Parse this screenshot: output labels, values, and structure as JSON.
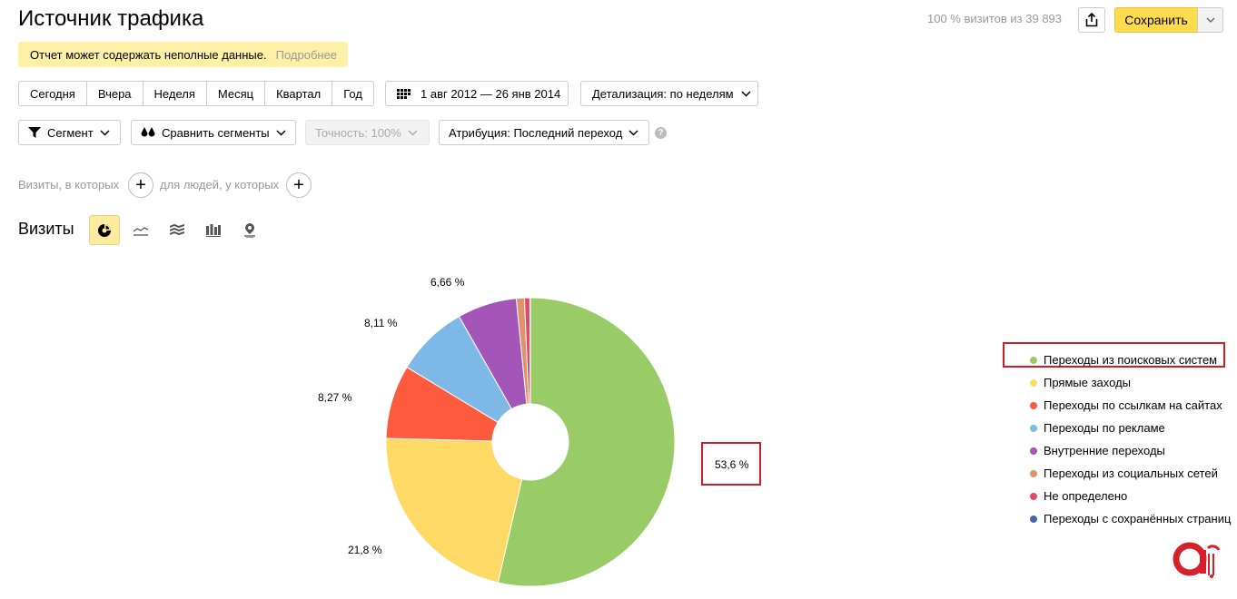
{
  "header": {
    "title": "Источник трафика",
    "visits_stat": "100 % визитов из 39 893",
    "save_label": "Сохранить"
  },
  "warning": {
    "text": "Отчет может содержать неполные данные.",
    "more": "Подробнее"
  },
  "periods": [
    "Сегодня",
    "Вчера",
    "Неделя",
    "Месяц",
    "Квартал",
    "Год"
  ],
  "date_range": "1 авг 2012 — 26 янв 2014",
  "detail": "Детализация: по неделям",
  "segments": {
    "segment": "Сегмент",
    "compare": "Сравнить сегменты",
    "accuracy": "Точность: 100%",
    "attribution": "Атрибуция: Последний переход"
  },
  "conditions": {
    "visits": "Визиты, в которых",
    "people": "для людей, у которых"
  },
  "chart_section": {
    "title": "Визиты"
  },
  "chart_data": {
    "type": "pie",
    "donut": true,
    "legend_position": "right",
    "labels": [
      "Переходы из поисковых систем",
      "Прямые заходы",
      "Переходы по ссылкам на сайтах",
      "Переходы по рекламе",
      "Внутренние переходы",
      "Переходы из социальных сетей",
      "Не определено",
      "Переходы с сохранённых страниц"
    ],
    "values": [
      53.6,
      21.8,
      8.27,
      8.11,
      6.66,
      0.9,
      0.6,
      0.06
    ],
    "value_labels": [
      "53,6 %",
      "21,8 %",
      "8,27 %",
      "8,11 %",
      "6,66 %",
      "",
      "",
      ""
    ],
    "colors": [
      "#99cc66",
      "#ffd966",
      "#ff5a3d",
      "#7eb8e6",
      "#a455b8",
      "#e0926a",
      "#e0486e",
      "#4466aa"
    ]
  }
}
